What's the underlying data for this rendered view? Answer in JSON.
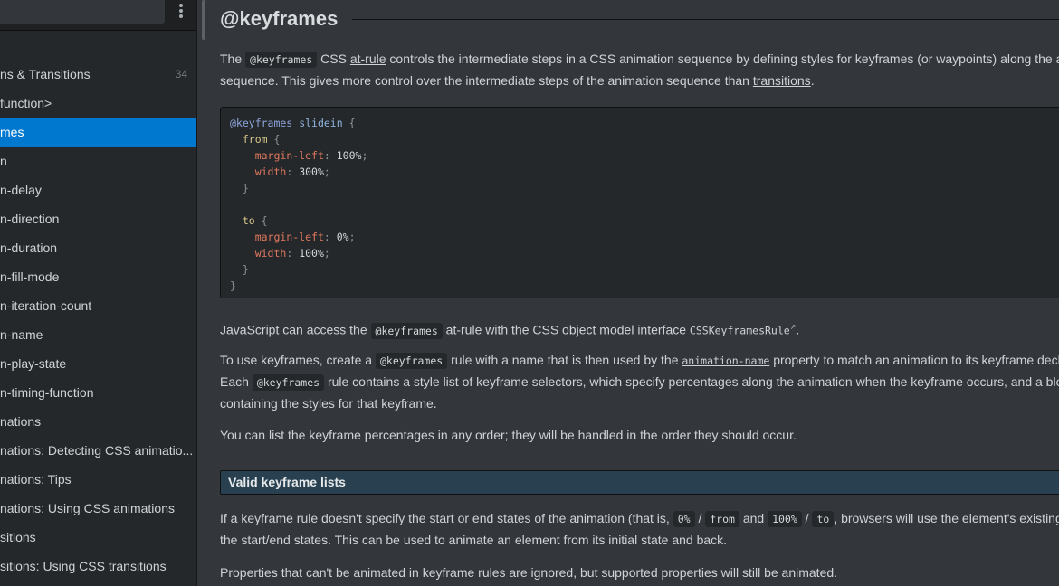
{
  "sidebar": {
    "more_menu_icon": "vertical-ellipsis",
    "items": [
      {
        "label": "ns & Transitions",
        "count": "34",
        "active": false
      },
      {
        "label": "function>",
        "active": false
      },
      {
        "label": "mes",
        "active": true
      },
      {
        "label": "n",
        "active": false
      },
      {
        "label": "n-delay",
        "active": false
      },
      {
        "label": "n-direction",
        "active": false
      },
      {
        "label": "n-duration",
        "active": false
      },
      {
        "label": "n-fill-mode",
        "active": false
      },
      {
        "label": "n-iteration-count",
        "active": false
      },
      {
        "label": "n-name",
        "active": false
      },
      {
        "label": "n-play-state",
        "active": false
      },
      {
        "label": "n-timing-function",
        "active": false
      },
      {
        "label": "nations",
        "active": false
      },
      {
        "label": "nations: Detecting CSS animatio...",
        "active": false
      },
      {
        "label": "nations: Tips",
        "active": false
      },
      {
        "label": "nations: Using CSS animations",
        "active": false
      },
      {
        "label": "sitions",
        "active": false
      },
      {
        "label": "sitions: Using CSS transitions",
        "active": false
      }
    ]
  },
  "article": {
    "title": "@keyframes",
    "intro": {
      "t1": "The ",
      "code1": "@keyframes",
      "t2": " CSS ",
      "link1": "at-rule",
      "t3": " controls the intermediate steps in a CSS animation sequence by defining styles for keyframes (or waypoints) along the an",
      "line2_t1": "sequence. This gives more control over the intermediate steps of the animation sequence than ",
      "link2": "transitions",
      "line2_t2": "."
    },
    "code_example": {
      "l1_at": "@keyframes",
      "l1_name": "slidein",
      "from_sel": "from",
      "from_prop1": "margin-left",
      "from_val1": "100%",
      "from_prop2": "width",
      "from_val2": "300%",
      "to_sel": "to",
      "to_prop1": "margin-left",
      "to_val1": "0%",
      "to_prop2": "width",
      "to_val2": "100%"
    },
    "js_para": {
      "t1": "JavaScript can access the ",
      "code1": "@keyframes",
      "t2": " at-rule with the CSS object model interface ",
      "link1": "CSSKeyframesRule",
      "t3": "."
    },
    "use_para": {
      "t1": "To use keyframes, create a ",
      "code1": "@keyframes",
      "t2": " rule with a name that is then used by the ",
      "link1": "animation-name",
      "t3": " property to match an animation to its keyframe decl",
      "l2_t1": "Each ",
      "l2_code1": "@keyframes",
      "l2_t2": " rule contains a style list of keyframe selectors, which specify percentages along the animation when the keyframe occurs, and a bloc",
      "l3": "containing the styles for that keyframe."
    },
    "order_para": "You can list the keyframe percentages in any order; they will be handled in the order they should occur.",
    "section_heading": "Valid keyframe lists",
    "valid_para": {
      "t1": "If a keyframe rule doesn't specify the start or end states of the animation (that is, ",
      "c1": "0%",
      "s1": " / ",
      "c2": "from",
      "t2": " and ",
      "c3": "100%",
      "s2": " / ",
      "c4": "to",
      "t3": ", browsers will use the element's existing st",
      "l2": "the start/end states. This can be used to animate an element from its initial state and back."
    },
    "props_para": "Properties that can't be animated in keyframe rules are ignored, but supported properties will still be animated."
  }
}
